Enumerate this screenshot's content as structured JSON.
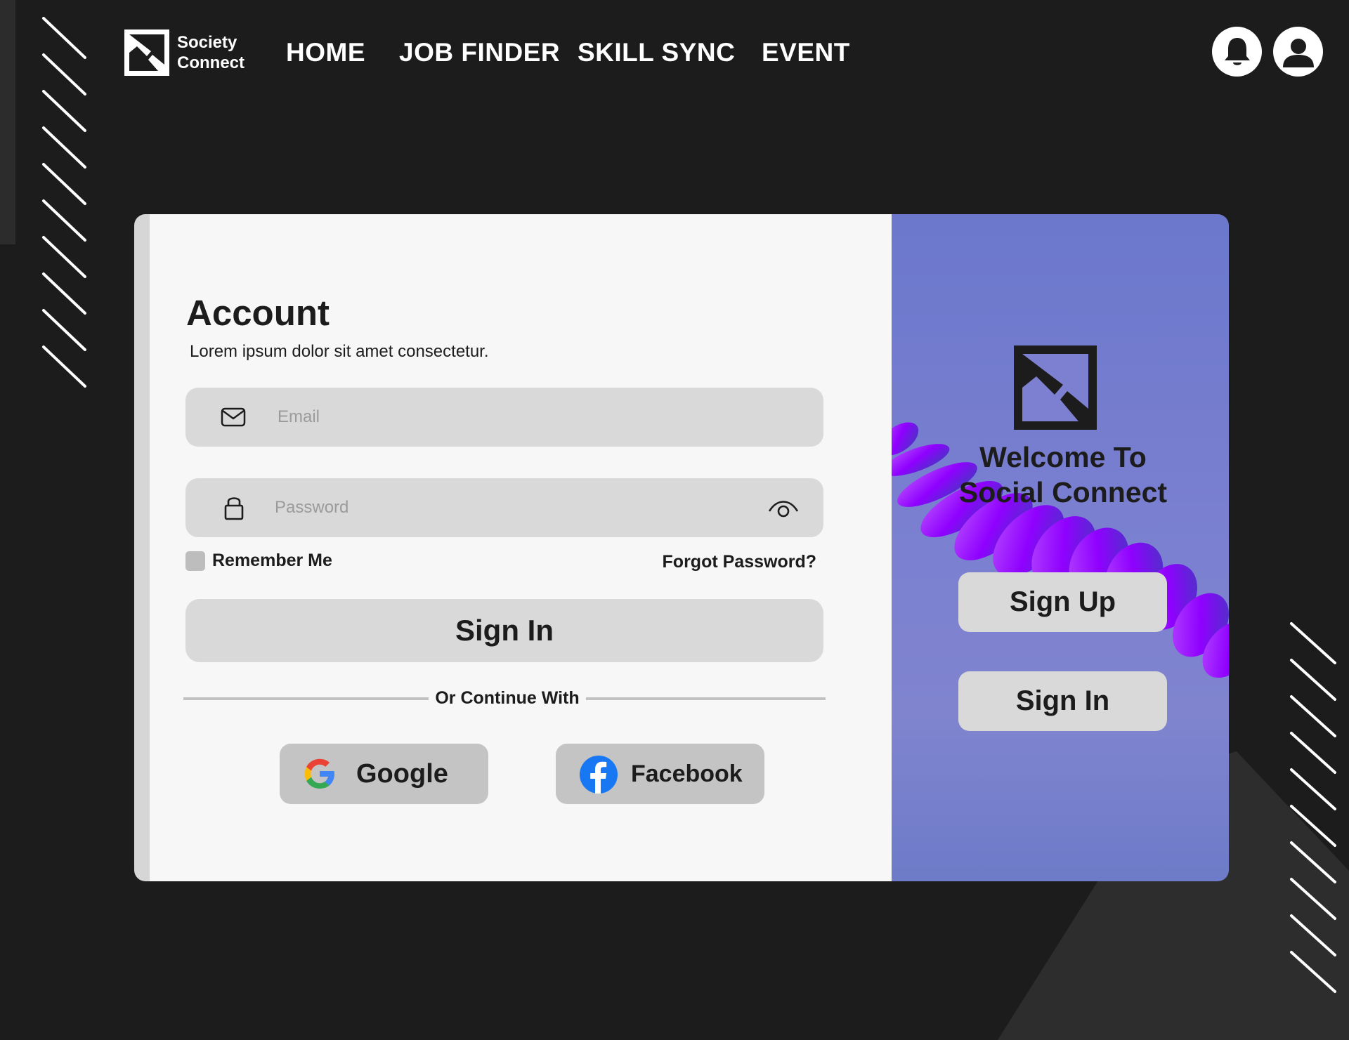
{
  "brand": {
    "line1": "Society",
    "line2": "Connect"
  },
  "nav": {
    "items": [
      {
        "label": "HOME"
      },
      {
        "label": "JOB FINDER"
      },
      {
        "label": "SKILL SYNC"
      },
      {
        "label": "EVENT"
      }
    ],
    "notification_icon": "bell-icon",
    "profile_icon": "user-icon"
  },
  "login": {
    "title": "Account",
    "subtitle": "Lorem ipsum dolor sit amet consectetur.",
    "email": {
      "placeholder": "Email",
      "value": "",
      "icon": "mail-icon"
    },
    "password": {
      "placeholder": "Password",
      "value": "",
      "icon": "lock-icon",
      "toggle_icon": "eye-icon"
    },
    "remember_label": "Remember Me",
    "remember_checked": false,
    "forgot_label": "Forgot Password?",
    "signin_label": "Sign In",
    "divider_label": "Or Continue With",
    "social": [
      {
        "label": "Google",
        "icon": "google-icon"
      },
      {
        "label": "Facebook",
        "icon": "facebook-icon"
      }
    ]
  },
  "welcome_panel": {
    "title_line1": "Welcome To",
    "title_line2": "Social Connect",
    "signup_label": "Sign Up",
    "signin_label": "Sign In"
  },
  "colors": {
    "background": "#1c1c1c",
    "card": "#f7f7f7",
    "field": "#d9d9d9",
    "panel": "#7a7fd0",
    "ribbon": "#9000ff",
    "facebook": "#1877f2"
  }
}
